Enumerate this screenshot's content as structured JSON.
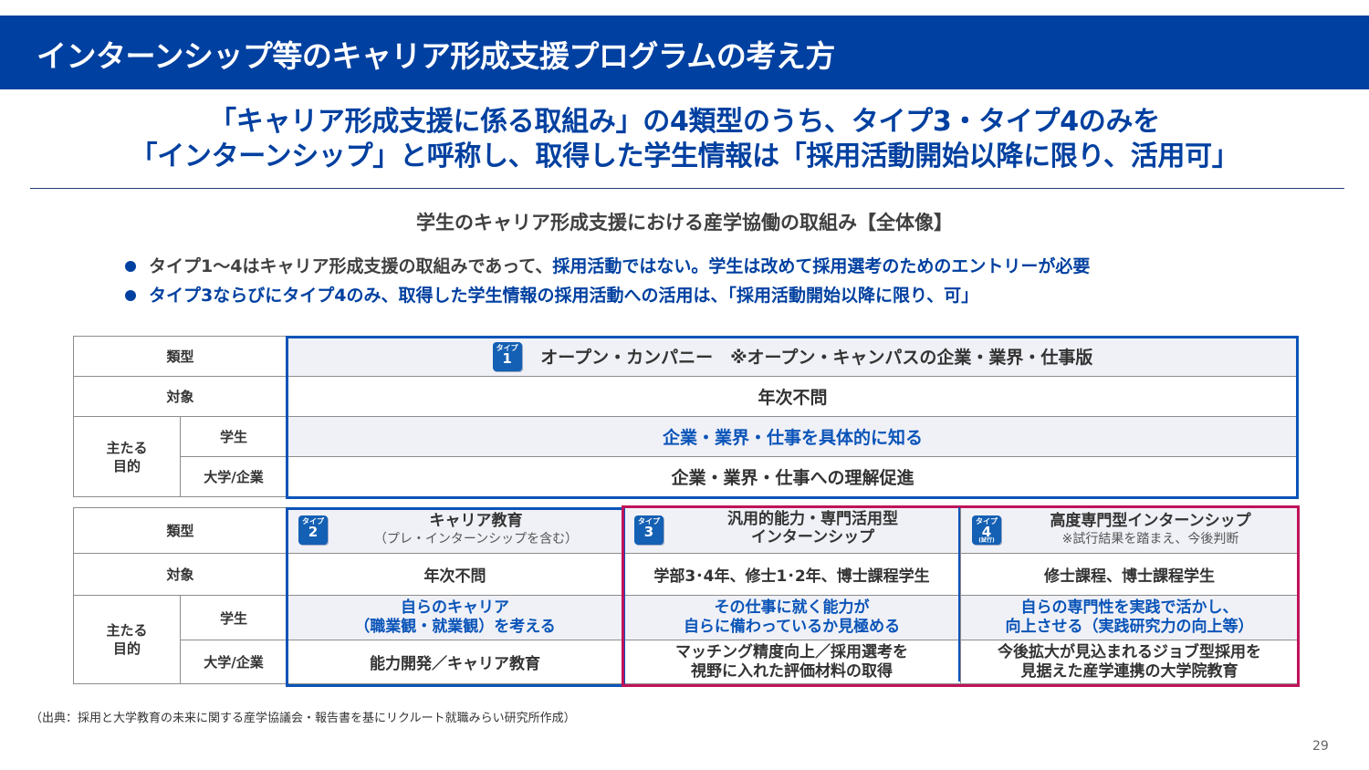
{
  "title": "インターンシップ等のキャリア形成支援プログラムの考え方",
  "headline": [
    "「キャリア形成支援に係る取組み」の4類型のうち、タイプ3・タイプ4のみを",
    "「インターンシップ」と呼称し、取得した学生情報は「採用活動開始以降に限り、活用可」"
  ],
  "subtitle": "学生のキャリア形成支援における産学協働の取組み【全体像】",
  "bullets": [
    {
      "black": "タイプ1～4はキャリア形成支援の取組みであって、",
      "blue": "採用活動ではない。学生は改めて採用選考のためのエントリーが必要"
    },
    {
      "black": "",
      "blue": "タイプ3ならびにタイプ4のみ、取得した学生情報の採用活動への活用は、「採用活動開始以降に限り、可」"
    }
  ],
  "row_labels": {
    "type": "類型",
    "target": "対象",
    "purpose": "主たる\n目的",
    "student": "学生",
    "univ_company": "大学/企業"
  },
  "badge_small": "タイプ",
  "type1": {
    "badge_num": "1",
    "name": "オープン・カンパニー　※オープン・キャンパスの企業・業界・仕事版",
    "target": "年次不問",
    "student": "企業・業界・仕事を具体的に知る",
    "univ_company": "企業・業界・仕事への理解促進"
  },
  "types": [
    {
      "badge_num": "2",
      "badge_extra": "",
      "name": "キャリア教育",
      "note": "（プレ・インターンシップを含む）",
      "target": "年次不問",
      "student": "自らのキャリア\n（職業観・就業観）を考える",
      "univ_company": "能力開発／キャリア教育"
    },
    {
      "badge_num": "3",
      "badge_extra": "",
      "name": "汎用的能力・専門活用型\nインターンシップ",
      "note": "",
      "target": "学部3･4年、修士1･2年、博士課程学生",
      "student": "その仕事に就く能力が\n自らに備わっているか見極める",
      "univ_company": "マッチング精度向上／採用選考を\n視野に入れた評価材料の取得"
    },
    {
      "badge_num": "4",
      "badge_extra": "(試行)",
      "name": "高度専門型インターンシップ",
      "note": "※試行結果を踏まえ、今後判断",
      "target": "修士課程、博士課程学生",
      "student": "自らの専門性を実践で活かし、\n向上させる（実践研究力の向上等）",
      "univ_company": "今後拡大が見込まれるジョブ型採用を\n見据えた産学連携の大学院教育"
    }
  ],
  "source": "（出典：採用と大学教育の未来に関する産学協議会・報告書を基にリクルート就職みらい研究所作成）",
  "page_number": "29",
  "colors": {
    "title_bar": "#0040a0",
    "accent_blue": "#0a54b8",
    "frame_red": "#c0135a"
  }
}
